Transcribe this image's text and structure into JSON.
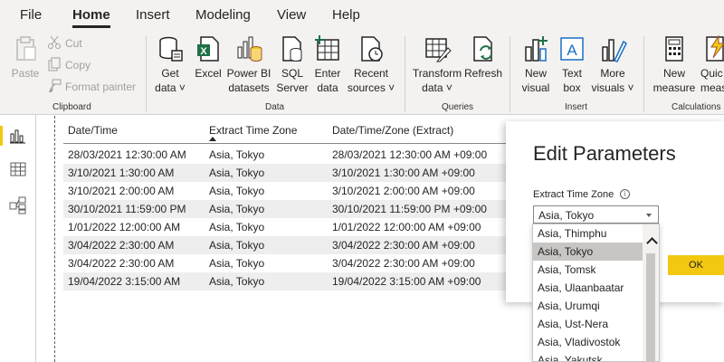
{
  "menu": {
    "file": "File",
    "home": "Home",
    "insert": "Insert",
    "modeling": "Modeling",
    "view": "View",
    "help": "Help"
  },
  "ribbon": {
    "paste": "Paste",
    "cut": "Cut",
    "copy": "Copy",
    "format_painter": "Format painter",
    "get_data_1": "Get",
    "get_data_2": "data",
    "excel": "Excel",
    "powerbi_1": "Power BI",
    "powerbi_2": "datasets",
    "sql_1": "SQL",
    "sql_2": "Server",
    "enter_1": "Enter",
    "enter_2": "data",
    "recent_1": "Recent",
    "recent_2": "sources",
    "transform_1": "Transform",
    "transform_2": "data",
    "refresh": "Refresh",
    "new_visual_1": "New",
    "new_visual_2": "visual",
    "textbox_1": "Text",
    "textbox_2": "box",
    "more_visuals_1": "More",
    "more_visuals_2": "visuals",
    "new_measure_1": "New",
    "new_measure_2": "measure",
    "quick_measure_1": "Quic",
    "quick_measure_2": "measu",
    "groups": {
      "clipboard": "Clipboard",
      "data": "Data",
      "queries": "Queries",
      "insert": "Insert",
      "calculations": "Calculations"
    }
  },
  "table": {
    "headers": [
      "Date/Time",
      "Extract Time Zone",
      "Date/Time/Zone (Extract)"
    ],
    "rows": [
      [
        "28/03/2021 12:30:00 AM",
        "Asia, Tokyo",
        "28/03/2021 12:30:00 AM +09:00"
      ],
      [
        "3/10/2021 1:30:00 AM",
        "Asia, Tokyo",
        "3/10/2021 1:30:00 AM +09:00"
      ],
      [
        "3/10/2021 2:00:00 AM",
        "Asia, Tokyo",
        "3/10/2021 2:00:00 AM +09:00"
      ],
      [
        "30/10/2021 11:59:00 PM",
        "Asia, Tokyo",
        "30/10/2021 11:59:00 PM +09:00"
      ],
      [
        "1/01/2022 12:00:00 AM",
        "Asia, Tokyo",
        "1/01/2022 12:00:00 AM +09:00"
      ],
      [
        "3/04/2022 2:30:00 AM",
        "Asia, Tokyo",
        "3/04/2022 2:30:00 AM +09:00"
      ],
      [
        "3/04/2022 2:30:00 AM",
        "Asia, Tokyo",
        "3/04/2022 2:30:00 AM +09:00"
      ],
      [
        "19/04/2022 3:15:00 AM",
        "Asia, Tokyo",
        "19/04/2022 3:15:00 AM +09:00"
      ]
    ]
  },
  "dialog": {
    "title": "Edit Parameters",
    "field_label": "Extract Time Zone",
    "info": "i",
    "selected_value": "Asia, Tokyo",
    "ok": "OK",
    "options": [
      "Asia, Thimphu",
      "Asia, Tokyo",
      "Asia, Tomsk",
      "Asia, Ulaanbaatar",
      "Asia, Urumqi",
      "Asia, Ust-Nera",
      "Asia, Vladivostok",
      "Asia, Yakutsk"
    ]
  },
  "colors": {
    "accent": "#f2c811",
    "ribbon_bg": "#f3f2f1",
    "excel_green": "#1e7145",
    "visual_blue": "#1a6fc4"
  }
}
